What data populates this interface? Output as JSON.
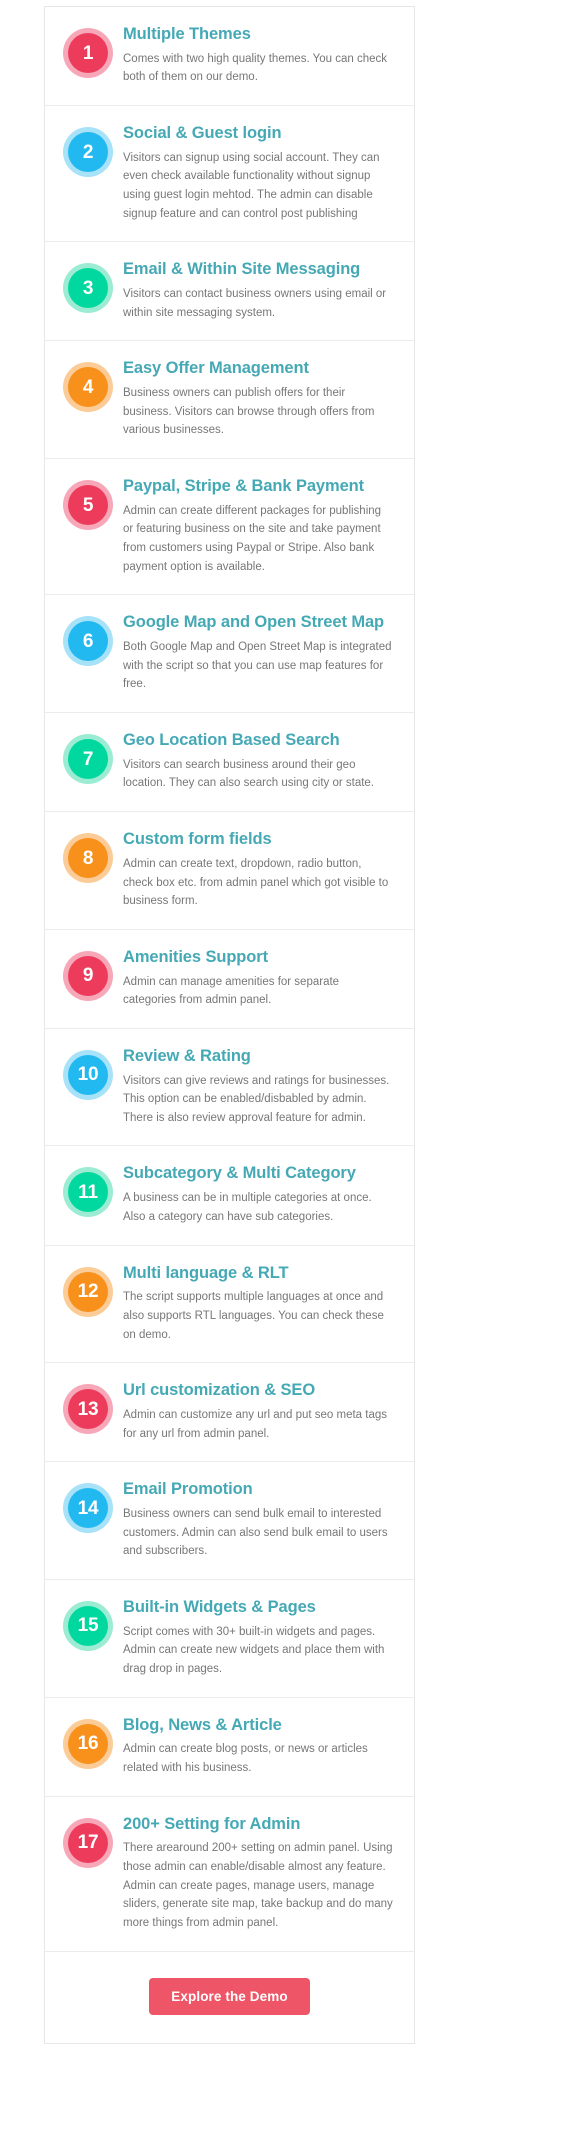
{
  "panel": {
    "accent_title_color": "#45a9b5",
    "body_text_color": "#777777",
    "border_color": "#ededed"
  },
  "features": [
    {
      "number": "1",
      "title": "Multiple Themes",
      "description": "Comes with two high quality themes. You can check both of them on our demo.",
      "color": "#ed3b5b",
      "ring": "#f6a8b8"
    },
    {
      "number": "2",
      "title": "Social & Guest login",
      "description": "Visitors can signup using social account. They can even check available functionality without signup using guest login mehtod. The admin can disable signup feature and can control post publishing",
      "color": "#22b9f0",
      "ring": "#a7e2f8"
    },
    {
      "number": "3",
      "title": "Email & Within Site Messaging",
      "description": "Visitors can contact business owners using email or within site messaging system.",
      "color": "#00d8a0",
      "ring": "#9cecd3"
    },
    {
      "number": "4",
      "title": "Easy Offer Management",
      "description": "Business owners can publish offers for their business. Visitors can browse through offers from various businesses.",
      "color": "#f8901c",
      "ring": "#fbcc97"
    },
    {
      "number": "5",
      "title": "Paypal, Stripe & Bank Payment",
      "description": "Admin can create different packages for publishing or featuring business on the site and take payment from customers using Paypal or Stripe. Also bank payment option is available.",
      "color": "#ed3b5b",
      "ring": "#f6a8b8"
    },
    {
      "number": "6",
      "title": "Google Map and Open Street Map",
      "description": "Both Google Map and Open Street Map is integrated with the script so that you can use map features for free.",
      "color": "#22b9f0",
      "ring": "#a7e2f8"
    },
    {
      "number": "7",
      "title": "Geo Location Based Search",
      "description": "Visitors can search business around their geo location. They can also search using city or state.",
      "color": "#00d8a0",
      "ring": "#9cecd3"
    },
    {
      "number": "8",
      "title": "Custom form fields",
      "description": "Admin can create text, dropdown, radio button, check box etc. from admin panel which got visible to business form.",
      "color": "#f8901c",
      "ring": "#fbcc97"
    },
    {
      "number": "9",
      "title": "Amenities Support",
      "description": "Admin can manage amenities for separate categories from admin panel.",
      "color": "#ed3b5b",
      "ring": "#f6a8b8"
    },
    {
      "number": "10",
      "title": "Review & Rating",
      "description": "Visitors can give reviews and ratings for businesses. This option can be enabled/disbabled by admin. There is also review approval feature for admin.",
      "color": "#22b9f0",
      "ring": "#a7e2f8"
    },
    {
      "number": "11",
      "title": "Subcategory & Multi Category",
      "description": "A business can be in multiple categories at once. Also a category can have sub categories.",
      "color": "#00d8a0",
      "ring": "#9cecd3"
    },
    {
      "number": "12",
      "title": "Multi language & RLT",
      "description": "The script supports multiple languages at once and also supports RTL languages. You can check these on demo.",
      "color": "#f8901c",
      "ring": "#fbcc97"
    },
    {
      "number": "13",
      "title": "Url customization & SEO",
      "description": "Admin can customize any url and put seo meta tags for any url from admin panel.",
      "color": "#ed3b5b",
      "ring": "#f6a8b8"
    },
    {
      "number": "14",
      "title": "Email Promotion",
      "description": "Business owners can send bulk email to interested customers. Admin can also send bulk email to users and subscribers.",
      "color": "#22b9f0",
      "ring": "#a7e2f8"
    },
    {
      "number": "15",
      "title": "Built-in Widgets & Pages",
      "description": "Script comes with 30+ built-in widgets and pages. Admin can create new widgets and place them with drag drop in pages.",
      "color": "#00d8a0",
      "ring": "#9cecd3"
    },
    {
      "number": "16",
      "title": "Blog, News & Article",
      "description": "Admin can create blog posts, or news or articles related with his business.",
      "color": "#f8901c",
      "ring": "#fbcc97"
    },
    {
      "number": "17",
      "title": "200+ Setting for Admin",
      "description": "There arearound 200+ setting on admin panel. Using those admin can enable/disable almost any feature. Admin can create pages, manage users, manage sliders, generate site map, take backup and do many more things from admin panel.",
      "color": "#ed3b5b",
      "ring": "#f6a8b8"
    }
  ],
  "cta": {
    "label": "Explore the Demo",
    "color": "#ee5566"
  }
}
